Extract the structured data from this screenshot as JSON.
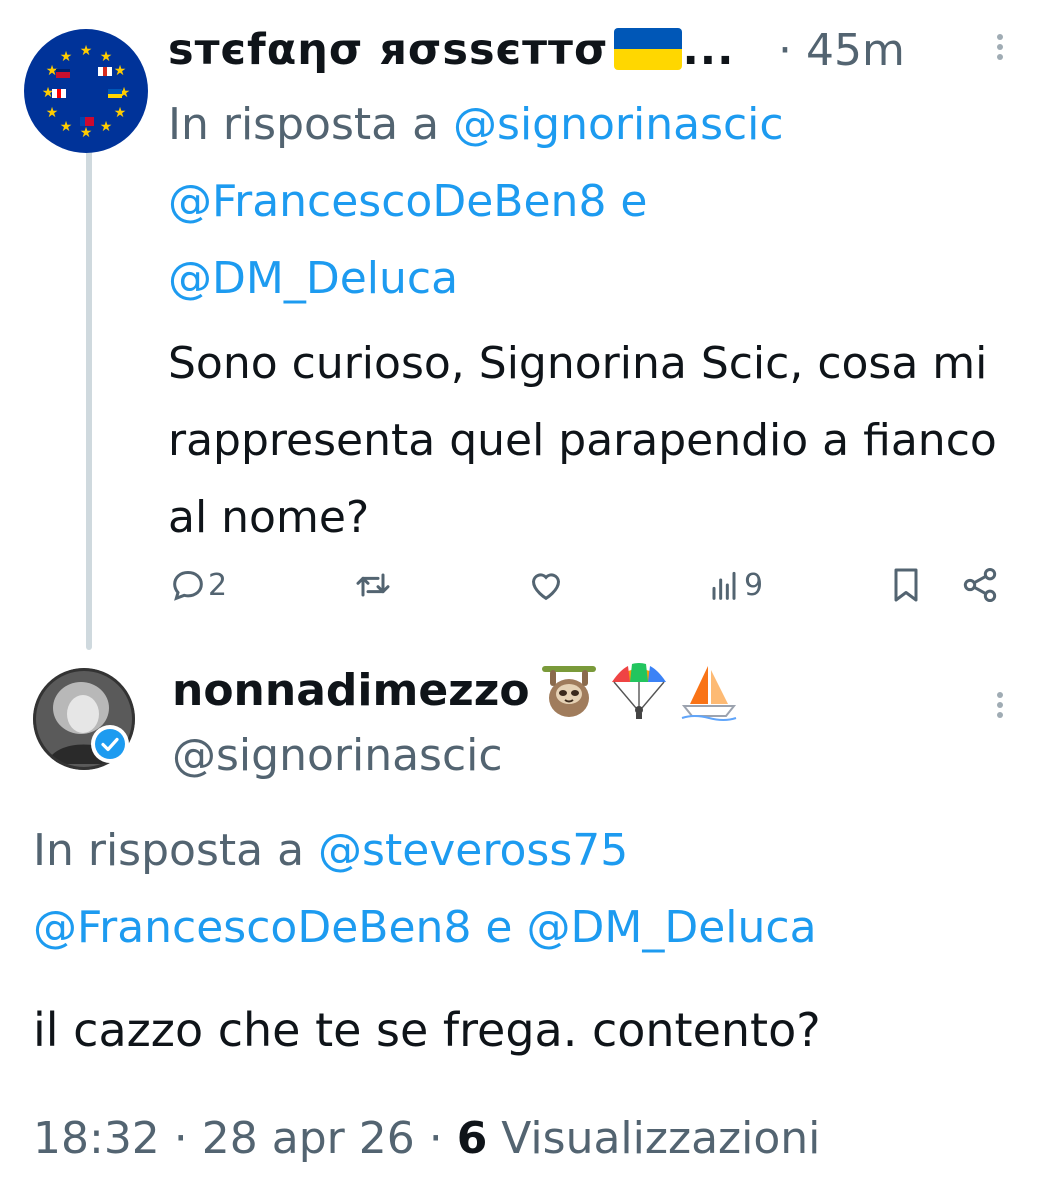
{
  "tweet1": {
    "display_name": "ѕтєfαησ яσѕѕєттσ",
    "flag_emoji": "🇺🇦",
    "name_ellipsis": "...",
    "time_sep": "·",
    "time": "45m",
    "reply_prefix": "In risposta a ",
    "mention_1": "@signorinascic",
    "mention_2": "@FrancescoDeBen8",
    "reply_joiner": " e ",
    "mention_3": "@DM_Deluca",
    "text": "Sono curioso, Signorina Scic, cosa mi rappresenta quel parapendio a fianco al nome?",
    "actions": {
      "replies": "2",
      "views": "9"
    }
  },
  "tweet2": {
    "display_name": "nonnadimezzo",
    "name_emojis": [
      "sloth",
      "parachute",
      "sailboat"
    ],
    "handle": "@signorinascic",
    "reply_prefix": "In risposta a ",
    "mention_1": "@steveross75",
    "mention_2": "@FrancescoDeBen8",
    "reply_joiner": " e ",
    "mention_3": "@DM_Deluca",
    "text": "il cazzo che te se frega. contento?",
    "time": "18:32",
    "sep1": " · ",
    "date": "28 apr 26",
    "sep2": " · ",
    "views_count": "6",
    "views_label": " Visualizzazioni"
  },
  "colors": {
    "accent": "#1d9bf0",
    "muted": "#536471",
    "text": "#0f1419",
    "thread_line": "#cfd9de"
  }
}
